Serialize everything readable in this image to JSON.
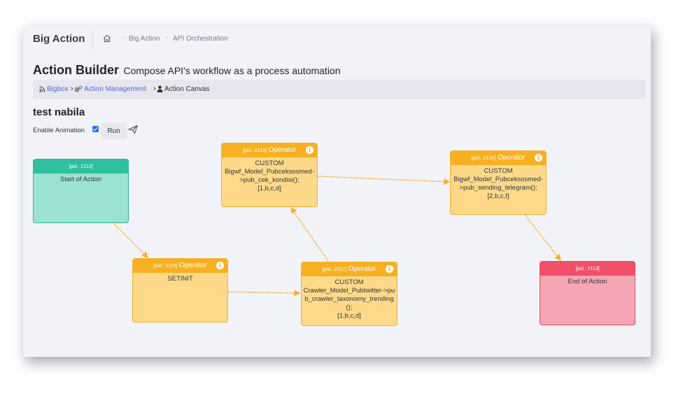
{
  "topbar": {
    "app_title": "Big Action",
    "breadcrumb": [
      "Big Action",
      "API Orchestration"
    ]
  },
  "page": {
    "title": "Action Builder",
    "subtitle": "Compose API's workflow as a process automation"
  },
  "breadcrumb_bar": {
    "items": [
      {
        "label": "Bigbox",
        "icon": "rss-icon"
      },
      {
        "label": "Action Management",
        "icon": "gears-icon"
      },
      {
        "label": "Action Canvas",
        "icon": "user-icon"
      }
    ]
  },
  "workflow": {
    "name": "test nabila",
    "enable_animation_label": "Enable Animation",
    "enable_animation_checked": true,
    "run_label": "Run"
  },
  "nodes": {
    "start": {
      "pid": "[pid : 2112]",
      "type": "",
      "body": "Start of Action",
      "color": "#2fc0a0"
    },
    "setinit": {
      "pid": "[pid : 2119]",
      "type": "Operator",
      "body": "SETINIT",
      "color": "#f6b021"
    },
    "cek_kondisi": {
      "pid": "[pid : 2116]",
      "type": "Operator",
      "body": "CUSTOM\nBigwf_Model_Pubceksosmed->pub_cek_kondisi();\n[1,b,c,d]",
      "color": "#f6b021"
    },
    "crawler": {
      "pid": "[pid : 2117]",
      "type": "Operator",
      "body": "CUSTOM\nCrawler_Model_Pubtwitter->pub_crawler_taxonomy_trending();\n[1,b,c,d]",
      "color": "#f6b021"
    },
    "telegram": {
      "pid": "[pid : 2120]",
      "type": "Operator",
      "body": "CUSTOM\nBigwf_Model_Pubceksosmed->pub_sending_telegram();\n[2,b,c,f]",
      "color": "#f6b021"
    },
    "end": {
      "pid": "[pid : 2113]",
      "type": "",
      "body": "End of Action",
      "color": "#f0506a"
    }
  },
  "colors": {
    "edge": "#f3b12b",
    "link": "#5a6ad0"
  }
}
